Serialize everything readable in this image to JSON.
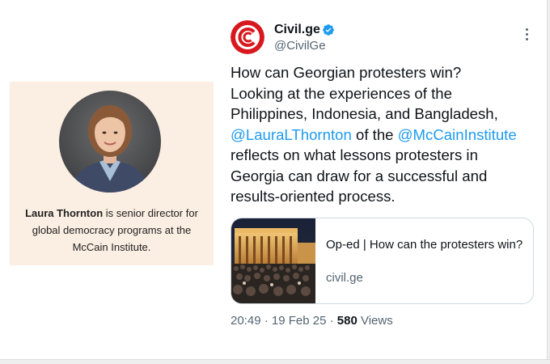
{
  "caption": {
    "name": "Laura Thornton",
    "line1_rest": " is senior director for",
    "line2": "global democracy programs at the",
    "line3": "McCain Institute."
  },
  "tweet": {
    "display_name": "Civil.ge",
    "handle": "@CivilGe",
    "text_lines": [
      "How can Georgian protesters win?",
      "Looking at the experiences of the",
      "Philippines, Indonesia, and Bangladesh,"
    ],
    "mention1": "@LauraLThornton",
    "mid_text": " of the ",
    "mention2": "@McCainInstitute",
    "text_lines_after": [
      "reflects on what lessons protesters in",
      "Georgia can draw for a successful and",
      "results-oriented process."
    ],
    "time": "20:49",
    "separator": " · ",
    "date": "19 Feb 25",
    "views_count": "580",
    "views_label": " Views"
  },
  "link_card": {
    "title": "Op-ed | How can the protesters win?",
    "domain": "civil.ge"
  },
  "icons": {
    "avatar": "civil-ge-logo",
    "verified": "verified-badge-icon",
    "more": "more-options-icon"
  },
  "colors": {
    "link_blue": "#1d9bf0",
    "brand_red": "#d7191f",
    "muted": "#536471",
    "card_bg": "#fbeee2"
  }
}
